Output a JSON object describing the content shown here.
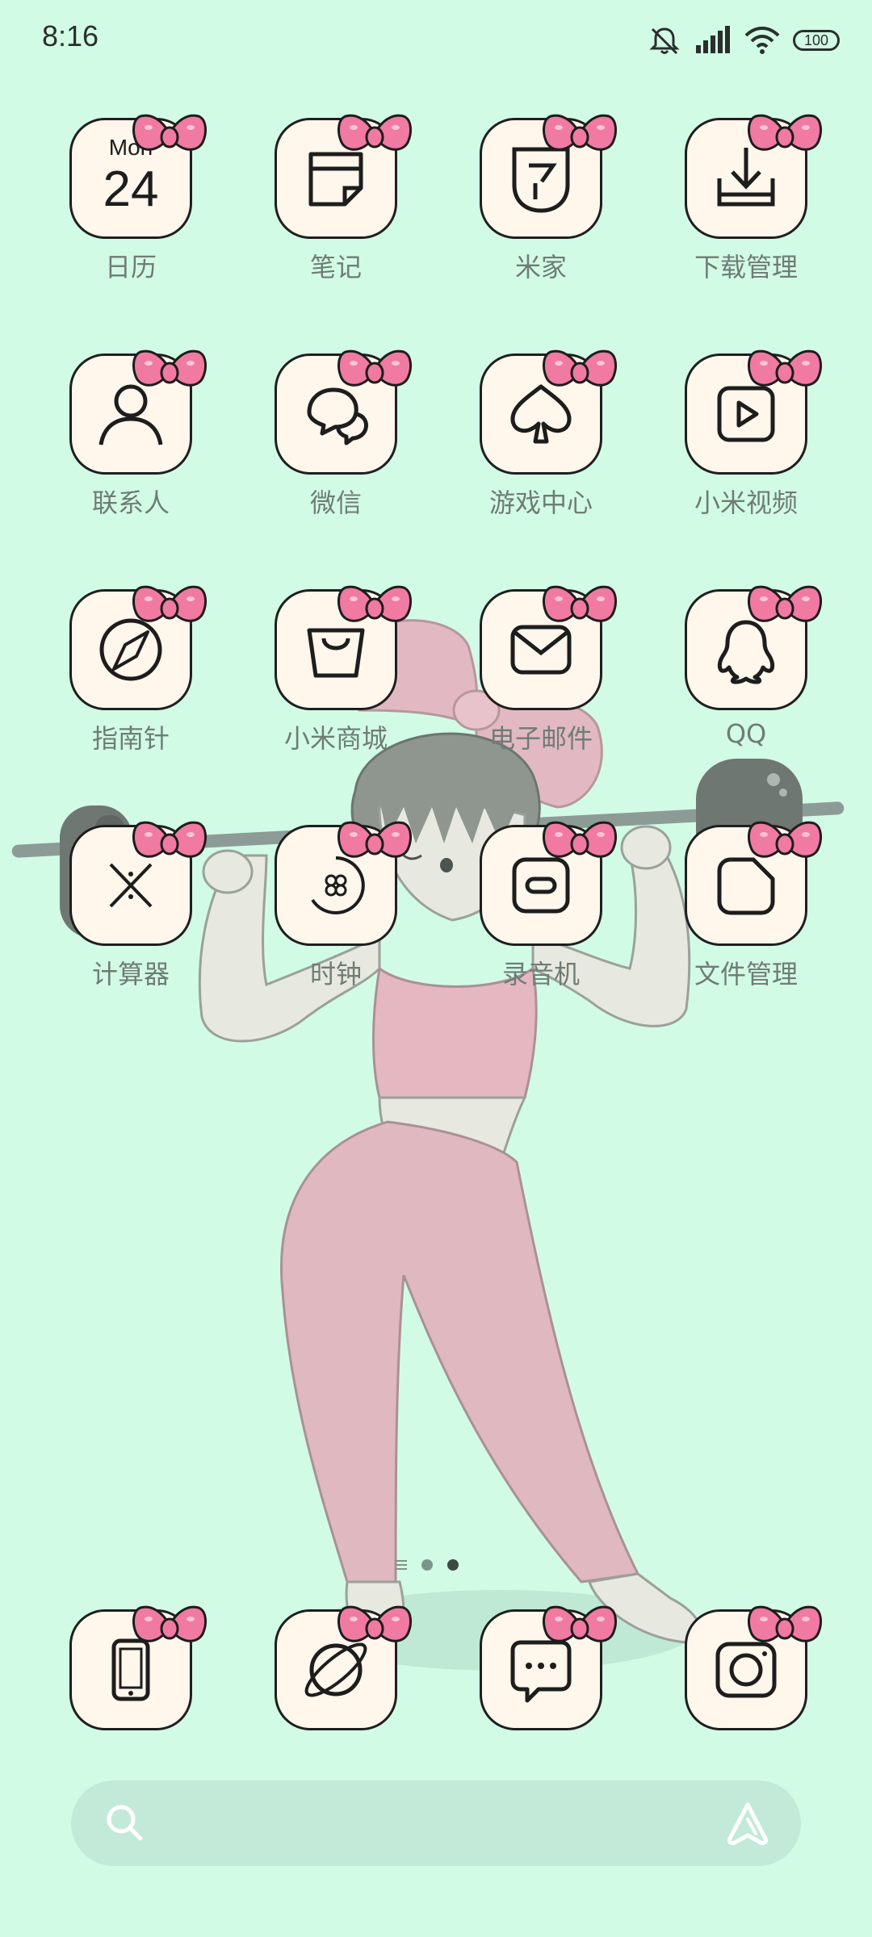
{
  "status_bar": {
    "time": "8:16",
    "battery_level": "100",
    "icons": [
      "mute-bell-icon",
      "signal-icon",
      "wifi-icon",
      "battery-icon"
    ]
  },
  "calendar_icon": {
    "weekday": "Mon",
    "day": "24"
  },
  "apps": [
    {
      "label": "日历",
      "icon": "calendar-icon"
    },
    {
      "label": "笔记",
      "icon": "notes-icon"
    },
    {
      "label": "米家",
      "icon": "mi-home-icon"
    },
    {
      "label": "下载管理",
      "icon": "download-icon"
    },
    {
      "label": "联系人",
      "icon": "contacts-icon"
    },
    {
      "label": "微信",
      "icon": "wechat-icon"
    },
    {
      "label": "游戏中心",
      "icon": "game-center-icon"
    },
    {
      "label": "小米视频",
      "icon": "video-icon"
    },
    {
      "label": "指南针",
      "icon": "compass-icon"
    },
    {
      "label": "小米商城",
      "icon": "mi-store-icon"
    },
    {
      "label": "电子邮件",
      "icon": "email-icon"
    },
    {
      "label": "QQ",
      "icon": "qq-icon"
    },
    {
      "label": "计算器",
      "icon": "calculator-icon"
    },
    {
      "label": "时钟",
      "icon": "clock-icon"
    },
    {
      "label": "录音机",
      "icon": "recorder-icon"
    },
    {
      "label": "文件管理",
      "icon": "file-manager-icon"
    }
  ],
  "dock": [
    {
      "icon": "phone-icon"
    },
    {
      "icon": "browser-icon"
    },
    {
      "icon": "messages-icon"
    },
    {
      "icon": "camera-icon"
    }
  ],
  "page_indicator": {
    "page_count": 2,
    "active_page": 2
  },
  "search": {
    "icons": [
      "search-icon",
      "assistant-icon"
    ]
  },
  "colors": {
    "background": "#d2fbe6",
    "icon_tile": "#fff6ec",
    "bow": "#f07aa2",
    "label": "#6f7c76"
  }
}
